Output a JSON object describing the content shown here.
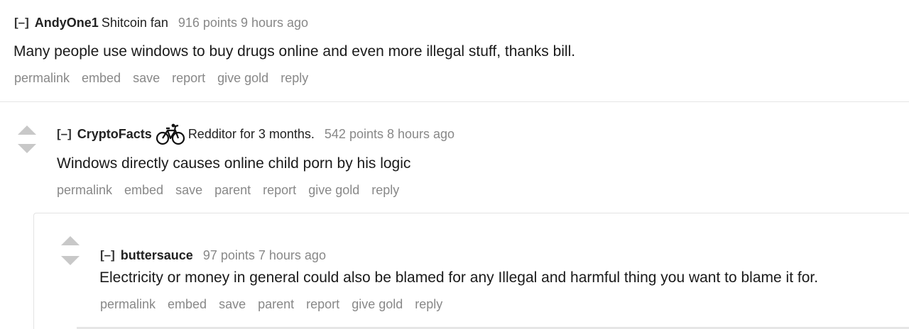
{
  "comments": [
    {
      "collapse": "[–]",
      "author": "AndyOne1",
      "flair": "Shitcoin fan",
      "meta": "916 points 9 hours ago",
      "body": "Many people use windows to buy drugs online and even more illegal stuff, thanks bill.",
      "actions": [
        "permalink",
        "embed",
        "save",
        "report",
        "give gold",
        "reply"
      ]
    },
    {
      "collapse": "[–]",
      "author": "CryptoFacts",
      "flair_icon": "bicycle-icon",
      "flair": "Redditor for 3 months.",
      "meta": "542 points 8 hours ago",
      "body": "Windows directly causes online child porn by his logic",
      "actions": [
        "permalink",
        "embed",
        "save",
        "parent",
        "report",
        "give gold",
        "reply"
      ]
    },
    {
      "collapse": "[–]",
      "author": "buttersauce",
      "meta": "97 points 7 hours ago",
      "body": "Electricity or money in general could also be blamed for any Illegal and harmful thing you want to blame it for.",
      "actions": [
        "permalink",
        "embed",
        "save",
        "parent",
        "report",
        "give gold",
        "reply"
      ]
    }
  ],
  "colors": {
    "meta_text": "#888888",
    "vote_arrow": "#c8c8c8",
    "divider": "#e6e6e6"
  }
}
